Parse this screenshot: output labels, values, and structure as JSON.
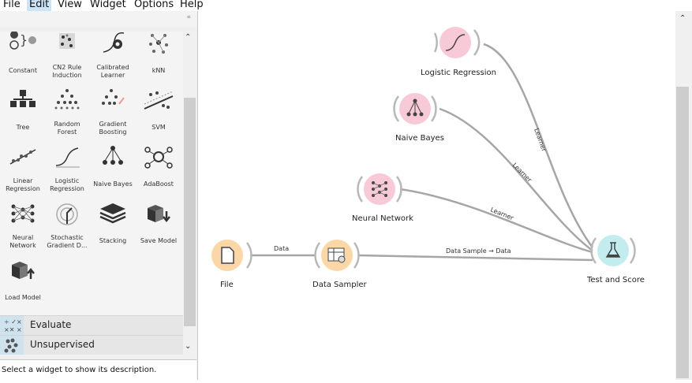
{
  "menu": [
    "File",
    "Edit",
    "View",
    "Widget",
    "Options",
    "Help"
  ],
  "widgets": [
    {
      "label1": "Constant",
      "label2": "",
      "icon": "constant-icon"
    },
    {
      "label1": "CN2 Rule",
      "label2": "Induction",
      "icon": "cn2-rule-icon"
    },
    {
      "label1": "Calibrated",
      "label2": "Learner",
      "icon": "calibrated-learner-icon"
    },
    {
      "label1": "kNN",
      "label2": "",
      "icon": "knn-icon"
    },
    {
      "label1": "Tree",
      "label2": "",
      "icon": "tree-icon"
    },
    {
      "label1": "Random",
      "label2": "Forest",
      "icon": "random-forest-icon"
    },
    {
      "label1": "Gradient",
      "label2": "Boosting",
      "icon": "gradient-boosting-icon"
    },
    {
      "label1": "SVM",
      "label2": "",
      "icon": "svm-icon"
    },
    {
      "label1": "Linear",
      "label2": "Regression",
      "icon": "linear-regression-icon"
    },
    {
      "label1": "Logistic",
      "label2": "Regression",
      "icon": "logistic-regression-icon"
    },
    {
      "label1": "Naive Bayes",
      "label2": "",
      "icon": "naive-bayes-icon"
    },
    {
      "label1": "AdaBoost",
      "label2": "",
      "icon": "adaboost-icon"
    },
    {
      "label1": "Neural",
      "label2": "Network",
      "icon": "neural-network-icon"
    },
    {
      "label1": "Stochastic",
      "label2": "Gradient D...",
      "icon": "stochastic-gradient-icon"
    },
    {
      "label1": "Stacking",
      "label2": "",
      "icon": "stacking-icon"
    },
    {
      "label1": "Save Model",
      "label2": "",
      "icon": "save-model-icon"
    },
    {
      "label1": "Load Model",
      "label2": "",
      "icon": "load-model-icon"
    }
  ],
  "categories": [
    "Evaluate",
    "Unsupervised"
  ],
  "description": "Select a widget to show its description.",
  "nodes": {
    "logistic_regression": "Logistic Regression",
    "naive_bayes": "Naive Bayes",
    "neural_network": "Neural Network",
    "file": "File",
    "data_sampler": "Data Sampler",
    "test_and_score": "Test and Score"
  },
  "links": {
    "learner1": "Learner",
    "learner2": "Learner",
    "learner3": "Learner",
    "data": "Data",
    "data_sample": "Data Sample → Data"
  },
  "colors": {
    "model_node": "#f8c9d6",
    "data_node": "#fbd7a8",
    "eval_node": "#c3ecee",
    "link": "#a0a0a0"
  }
}
